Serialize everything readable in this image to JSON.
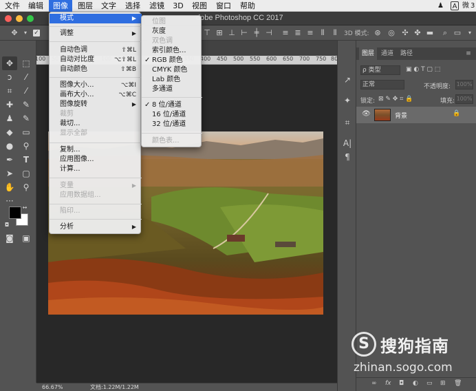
{
  "menubar": {
    "items": [
      "文件",
      "编辑",
      "图像",
      "图层",
      "文字",
      "选择",
      "滤镜",
      "3D",
      "视图",
      "窗口",
      "帮助"
    ],
    "active_index": 2,
    "tray": [
      "A",
      "微",
      "3"
    ]
  },
  "window": {
    "title": "dobe Photoshop CC 2017"
  },
  "options_bar": {
    "mode_3d_label": "3D 模式:"
  },
  "toolbar": {
    "tools": [
      "move-tool",
      "marquee-tool",
      "lasso-tool",
      "magic-wand-tool",
      "crop-tool",
      "eyedropper-tool",
      "healing-brush-tool",
      "brush-tool",
      "clone-stamp-tool",
      "history-brush-tool",
      "eraser-tool",
      "gradient-tool",
      "blur-tool",
      "dodge-tool",
      "pen-tool",
      "type-tool",
      "path-selection-tool",
      "shape-tool",
      "hand-tool",
      "zoom-tool",
      "more-tools"
    ],
    "foreground_color": "#000000",
    "background_color": "#ffffff"
  },
  "ruler": {
    "ticks": [
      "100",
      "50",
      "0",
      "50",
      "100",
      "150",
      "200",
      "250",
      "300",
      "350",
      "400",
      "450",
      "500",
      "550",
      "600",
      "650",
      "700",
      "750",
      "800"
    ]
  },
  "status": {
    "zoom": "66.67%",
    "doc": "文档:1.22M/1.22M"
  },
  "image_menu": {
    "items": [
      {
        "label": "模式",
        "shortcut": "",
        "submenu": true,
        "disabled": false,
        "highlight": true
      },
      {
        "label": "调整",
        "shortcut": "",
        "submenu": true,
        "disabled": false,
        "highlight": false
      },
      {
        "label": "自动色调",
        "shortcut": "⇧⌘L",
        "submenu": false,
        "disabled": false
      },
      {
        "label": "自动对比度",
        "shortcut": "⌥⇧⌘L",
        "submenu": false,
        "disabled": false
      },
      {
        "label": "自动颜色",
        "shortcut": "⇧⌘B",
        "submenu": false,
        "disabled": false
      },
      {
        "label": "图像大小...",
        "shortcut": "⌥⌘I",
        "submenu": false,
        "disabled": false
      },
      {
        "label": "画布大小...",
        "shortcut": "⌥⌘C",
        "submenu": false,
        "disabled": false
      },
      {
        "label": "图像旋转",
        "shortcut": "",
        "submenu": true,
        "disabled": false
      },
      {
        "label": "裁剪",
        "shortcut": "",
        "submenu": false,
        "disabled": true
      },
      {
        "label": "裁切...",
        "shortcut": "",
        "submenu": false,
        "disabled": false
      },
      {
        "label": "显示全部",
        "shortcut": "",
        "submenu": false,
        "disabled": true
      },
      {
        "label": "复制...",
        "shortcut": "",
        "submenu": false,
        "disabled": false
      },
      {
        "label": "应用图像...",
        "shortcut": "",
        "submenu": false,
        "disabled": false
      },
      {
        "label": "计算...",
        "shortcut": "",
        "submenu": false,
        "disabled": false
      },
      {
        "label": "变量",
        "shortcut": "",
        "submenu": true,
        "disabled": true
      },
      {
        "label": "应用数据组...",
        "shortcut": "",
        "submenu": false,
        "disabled": true
      },
      {
        "label": "陷印...",
        "shortcut": "",
        "submenu": false,
        "disabled": true
      },
      {
        "label": "分析",
        "shortcut": "",
        "submenu": true,
        "disabled": false
      }
    ]
  },
  "mode_menu": {
    "items": [
      {
        "label": "位图",
        "checked": false,
        "disabled": true
      },
      {
        "label": "灰度",
        "checked": false,
        "disabled": false
      },
      {
        "label": "双色调",
        "checked": false,
        "disabled": true
      },
      {
        "label": "索引颜色...",
        "checked": false,
        "disabled": false
      },
      {
        "label": "RGB 颜色",
        "checked": true,
        "disabled": false
      },
      {
        "label": "CMYK 颜色",
        "checked": false,
        "disabled": false
      },
      {
        "label": "Lab 颜色",
        "checked": false,
        "disabled": false
      },
      {
        "label": "多通道",
        "checked": false,
        "disabled": false
      },
      {
        "label": "8 位/通道",
        "checked": true,
        "disabled": false
      },
      {
        "label": "16 位/通道",
        "checked": false,
        "disabled": false
      },
      {
        "label": "32 位/通道",
        "checked": false,
        "disabled": false
      },
      {
        "label": "颜色表...",
        "checked": false,
        "disabled": true
      }
    ]
  },
  "layers_panel": {
    "tabs": [
      "图层",
      "通道",
      "路径"
    ],
    "active_tab": 0,
    "filter": "ρ 类型",
    "blend_mode": "正常",
    "opacity_label": "不透明度:",
    "opacity_value": "100%",
    "lock_label": "锁定:",
    "fill_label": "填充:",
    "fill_value": "100%",
    "layer_name": "背景"
  },
  "watermark": {
    "text": "搜狗指南",
    "url": "zhinan.sogo.com"
  }
}
